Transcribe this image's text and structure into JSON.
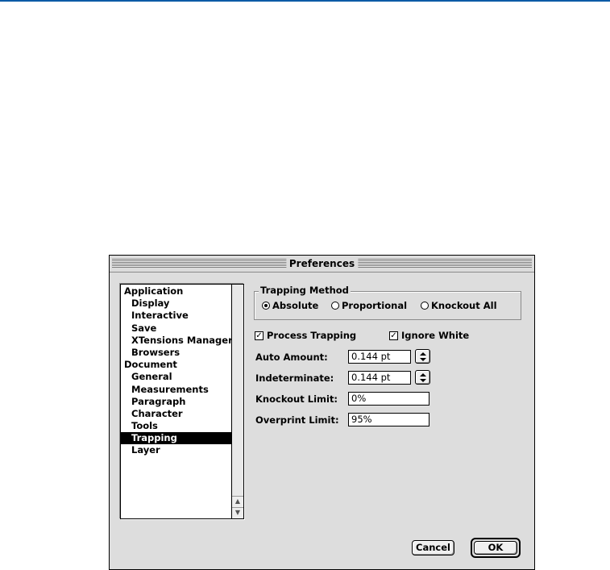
{
  "window": {
    "title": "Preferences"
  },
  "categories": [
    {
      "label": "Application",
      "level": 0,
      "selected": false
    },
    {
      "label": "Display",
      "level": 1,
      "selected": false
    },
    {
      "label": "Interactive",
      "level": 1,
      "selected": false
    },
    {
      "label": "Save",
      "level": 1,
      "selected": false
    },
    {
      "label": "XTensions Manager",
      "level": 1,
      "selected": false
    },
    {
      "label": "Browsers",
      "level": 1,
      "selected": false
    },
    {
      "label": "Document",
      "level": 0,
      "selected": false
    },
    {
      "label": "General",
      "level": 1,
      "selected": false
    },
    {
      "label": "Measurements",
      "level": 1,
      "selected": false
    },
    {
      "label": "Paragraph",
      "level": 1,
      "selected": false
    },
    {
      "label": "Character",
      "level": 1,
      "selected": false
    },
    {
      "label": "Tools",
      "level": 1,
      "selected": false
    },
    {
      "label": "Trapping",
      "level": 1,
      "selected": true
    },
    {
      "label": "Layer",
      "level": 1,
      "selected": false
    }
  ],
  "trapping_method": {
    "label": "Trapping Method",
    "options": [
      {
        "label": "Absolute",
        "checked": true
      },
      {
        "label": "Proportional",
        "checked": false
      },
      {
        "label": "Knockout All",
        "checked": false
      }
    ]
  },
  "checkboxes": {
    "process_trapping": {
      "label": "Process Trapping",
      "checked": true
    },
    "ignore_white": {
      "label": "Ignore White",
      "checked": true
    }
  },
  "fields": {
    "auto_amount": {
      "label": "Auto Amount:",
      "value": "0.144  pt"
    },
    "indeterminate": {
      "label": "Indeterminate:",
      "value": "0.144  pt"
    },
    "knockout_limit": {
      "label": "Knockout Limit:",
      "value": "0%"
    },
    "overprint_limit": {
      "label": "Overprint Limit:",
      "value": "95%"
    }
  },
  "buttons": {
    "cancel": "Cancel",
    "ok": "OK"
  },
  "icons": {
    "check": "✓",
    "scroll_up": "▲",
    "scroll_down": "▼"
  },
  "colors": {
    "accent_rule": "#0a5aa6",
    "window_bg": "#dddddd",
    "selection": "#000000"
  }
}
